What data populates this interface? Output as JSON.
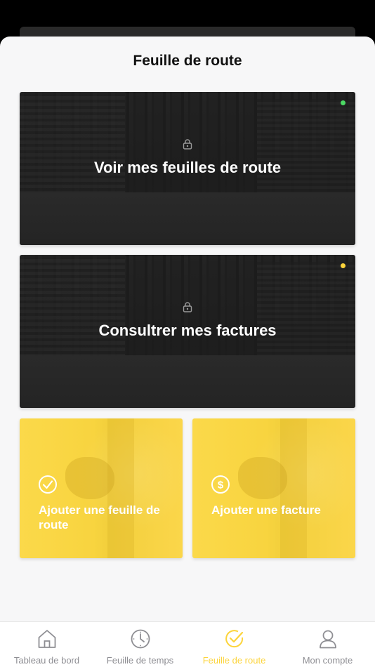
{
  "title": "Feuille de route",
  "cards": [
    {
      "label": "Voir mes feuilles de route",
      "dot_color": "#4cd964"
    },
    {
      "label": "Consultrer mes factures",
      "dot_color": "#fcd43b"
    }
  ],
  "actions": [
    {
      "label": "Ajouter une feuille de route",
      "icon": "check-circle-icon"
    },
    {
      "label": "Ajouter une facture",
      "icon": "dollar-circle-icon"
    }
  ],
  "tabs": [
    {
      "label": "Tableau de bord",
      "icon": "home-icon",
      "active": false
    },
    {
      "label": "Feuille de temps",
      "icon": "clock-icon",
      "active": false
    },
    {
      "label": "Feuille de route",
      "icon": "check-circle-icon",
      "active": true
    },
    {
      "label": "Mon compte",
      "icon": "user-icon",
      "active": false
    }
  ],
  "colors": {
    "accent": "#fcd43b",
    "inactive": "#8e8e93"
  }
}
